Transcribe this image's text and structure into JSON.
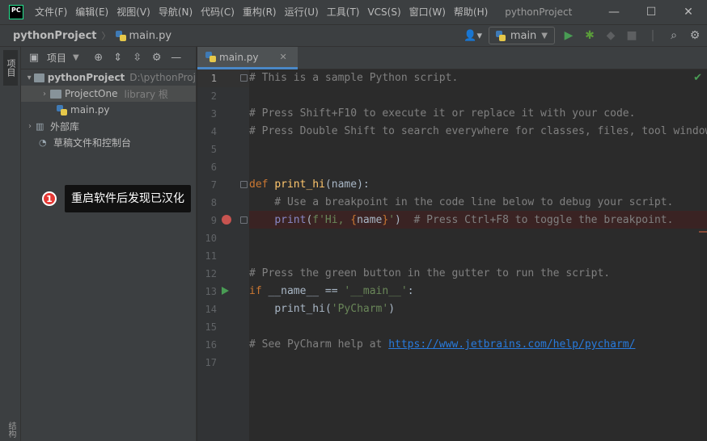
{
  "app": {
    "logo": "PC",
    "window_title": "pythonProject"
  },
  "menu": [
    {
      "label": "文件(F)"
    },
    {
      "label": "编辑(E)"
    },
    {
      "label": "视图(V)"
    },
    {
      "label": "导航(N)"
    },
    {
      "label": "代码(C)"
    },
    {
      "label": "重构(R)"
    },
    {
      "label": "运行(U)"
    },
    {
      "label": "工具(T)"
    },
    {
      "label": "VCS(S)"
    },
    {
      "label": "窗口(W)"
    },
    {
      "label": "帮助(H)"
    }
  ],
  "window_controls": {
    "minimize": "—",
    "maximize": "☐",
    "close": "✕"
  },
  "navbar": {
    "project": "pythonProject",
    "file": "main.py",
    "run_config": "main"
  },
  "left_strip": {
    "project_tab": "项目",
    "bottom_tab": "结构"
  },
  "project_panel": {
    "title": "项目",
    "tree": [
      {
        "label": "pythonProject",
        "path": "D:\\pythonProj"
      },
      {
        "label": "ProjectOne",
        "suffix": "library 根"
      },
      {
        "label": "main.py"
      },
      {
        "label": "外部库"
      },
      {
        "label": "草稿文件和控制台"
      }
    ]
  },
  "callout": {
    "number": "1",
    "text": "重启软件后发现已汉化"
  },
  "editor": {
    "tab": "main.py",
    "line_numbers": [
      "1",
      "2",
      "3",
      "4",
      "5",
      "6",
      "7",
      "8",
      "9",
      "10",
      "11",
      "12",
      "13",
      "14",
      "15",
      "16",
      "17"
    ],
    "lines": {
      "l1": "# This is a sample Python script.",
      "l3": "# Press Shift+F10 to execute it or replace it with your code.",
      "l4": "# Press Double Shift to search everywhere for classes, files, tool windows, actions, and settings.",
      "l7_kw": "def ",
      "l7_fn": "print_hi",
      "l7_rest": "(name):",
      "l8": "    # Use a breakpoint in the code line below to debug your script.",
      "l9_indent": "    ",
      "l9_fn": "print",
      "l9_open": "(",
      "l9_str1": "f'Hi, ",
      "l9_brace1": "{",
      "l9_name": "name",
      "l9_brace2": "}",
      "l9_str2": "'",
      "l9_close": ")  ",
      "l9_comment": "# Press Ctrl+F8 to toggle the breakpoint.",
      "l12": "# Press the green button in the gutter to run the script.",
      "l13_kw": "if ",
      "l13_dunder": "__name__",
      "l13_op": " == ",
      "l13_str": "'__main__'",
      "l13_colon": ":",
      "l14_indent": "    ",
      "l14_fn": "print_hi",
      "l14_open": "(",
      "l14_str": "'PyCharm'",
      "l14_close": ")",
      "l16_comment": "# See PyCharm help at ",
      "l16_link": "https://www.jetbrains.com/help/pycharm/"
    }
  },
  "colors": {
    "background": "#2b2b2b",
    "panel": "#3c3f41",
    "keyword": "#cc7832",
    "function": "#ffc66d",
    "string": "#6a8759",
    "comment": "#808080",
    "breakpoint": "#c75450",
    "run": "#499c54"
  }
}
